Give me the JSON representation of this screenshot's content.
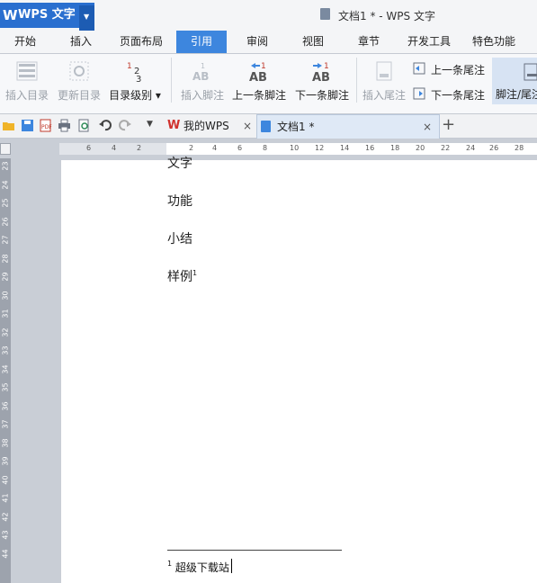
{
  "app": {
    "name": "WPS 文字",
    "logo": "W",
    "window_title": "文档1 * - WPS 文字"
  },
  "menu": {
    "tabs": [
      "开始",
      "插入",
      "页面布局",
      "引用",
      "审阅",
      "视图",
      "章节",
      "开发工具",
      "特色功能"
    ],
    "active": "引用"
  },
  "ribbon": {
    "insert_toc": "插入目录",
    "update_toc": "更新目录",
    "toc_level": "目录级别",
    "insert_footnote": "插入脚注",
    "prev_footnote": "上一条脚注",
    "next_footnote": "下一条脚注",
    "insert_endnote": "插入尾注",
    "prev_endnote": "上一条尾注",
    "next_endnote": "下一条尾注",
    "footnote_endnote": "脚注/尾注",
    "ab": "AB",
    "one": "1"
  },
  "tabs": {
    "my_wps": "我的WPS",
    "doc1": "文档1 *",
    "close": "×",
    "add": "+"
  },
  "ruler": {
    "h_ticks": [
      "6",
      "4",
      "2",
      "2",
      "4",
      "6",
      "8",
      "10",
      "12",
      "14",
      "16",
      "18",
      "20",
      "22",
      "24",
      "26",
      "28"
    ],
    "v_ticks": [
      "23",
      "24",
      "25",
      "26",
      "27",
      "28",
      "29",
      "30",
      "31",
      "32",
      "33",
      "34",
      "35",
      "36",
      "37",
      "38",
      "39",
      "40",
      "41",
      "42",
      "43",
      "44"
    ]
  },
  "document": {
    "lines": [
      "文字",
      "功能",
      "小结"
    ],
    "footnote_anchor_text": "样例",
    "footnote_mark": "1",
    "footnote_text": "超级下载站"
  },
  "colors": {
    "accent": "#3d86de",
    "app_blue": "#2a6fcf"
  }
}
